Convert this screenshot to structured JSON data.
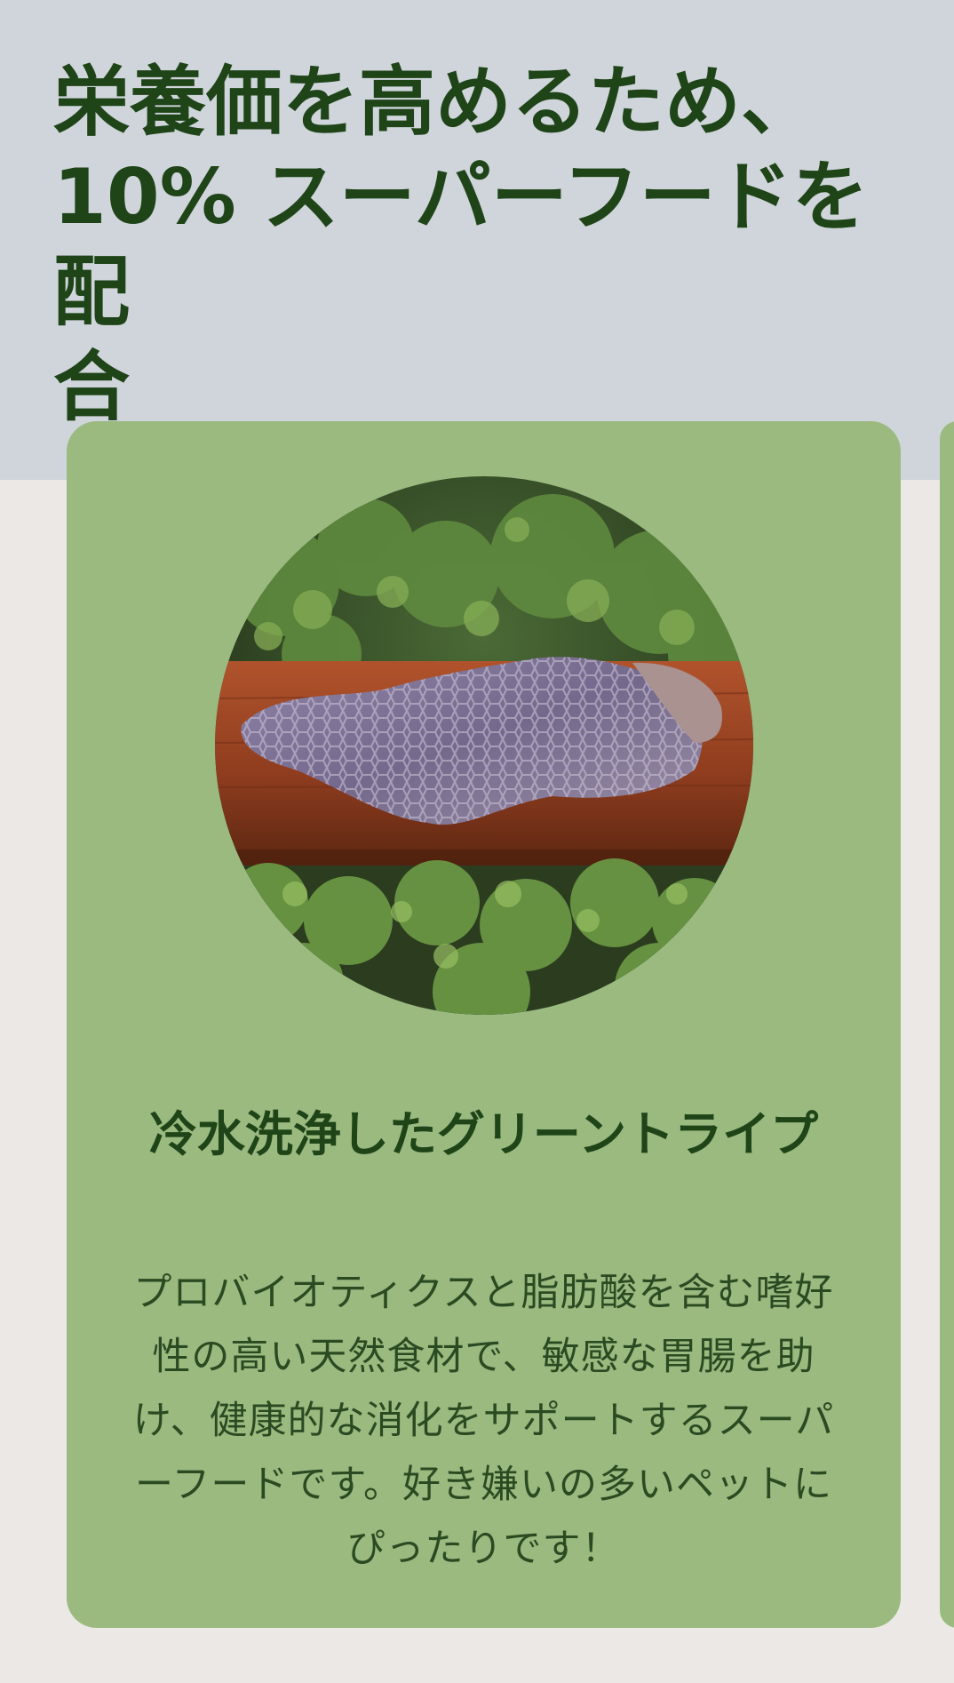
{
  "section": {
    "title": "栄養価を高めるため、\n10% スーパーフードを配\n合"
  },
  "card": {
    "image_subject": "green-tripe-photo",
    "title": "冷水洗浄したグリーントライプ",
    "body": "プロバイオティクスと脂肪酸を含む嗜好性の高い天然食材で、敏感な胃腸を助け、健康的な消化をサポートするスーパーフードです。好き嫌いの多いペットにぴったりです！"
  },
  "colors": {
    "top_band": "#d0d5db",
    "page_background": "#ebe8e5",
    "card_background": "#9bba80",
    "text_dark_green": "#1e4418"
  }
}
